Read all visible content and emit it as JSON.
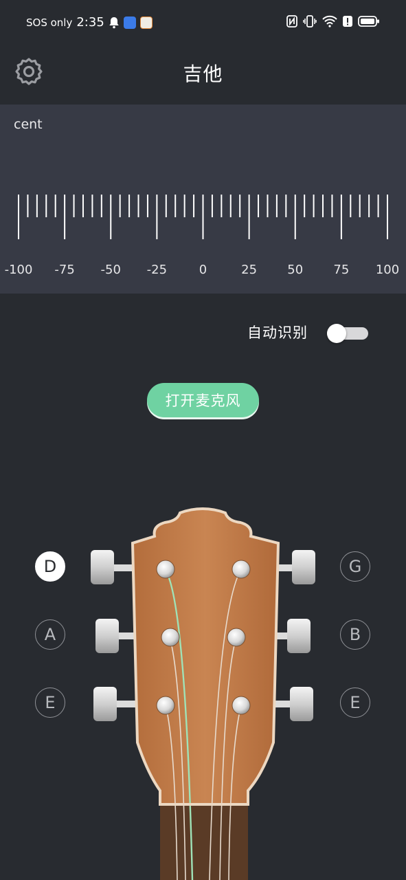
{
  "status_bar": {
    "carrier": "SOS only",
    "time": "2:35",
    "icons": [
      "bell-icon",
      "app-icon-blue",
      "app-icon-orange",
      "nfc-icon",
      "vibrate-icon",
      "wifi-icon",
      "alert-icon",
      "battery-icon"
    ]
  },
  "header": {
    "title": "吉他",
    "settings_icon": "gear-icon"
  },
  "meter": {
    "unit_label": "cent",
    "tick_labels": [
      "-100",
      "-75",
      "-50",
      "-25",
      "0",
      "25",
      "50",
      "75",
      "100"
    ]
  },
  "auto_detect": {
    "label": "自动识别",
    "enabled": false
  },
  "mic_button": {
    "label": "打开麦克风"
  },
  "strings": {
    "left": [
      {
        "note": "D",
        "active": true
      },
      {
        "note": "A",
        "active": false
      },
      {
        "note": "E",
        "active": false
      }
    ],
    "right": [
      {
        "note": "G",
        "active": false
      },
      {
        "note": "B",
        "active": false
      },
      {
        "note": "E",
        "active": false
      }
    ]
  },
  "colors": {
    "background": "#282b30",
    "meter_background": "#373a45",
    "accent_green": "#6fd2a2",
    "wood": "#c27d4a"
  }
}
